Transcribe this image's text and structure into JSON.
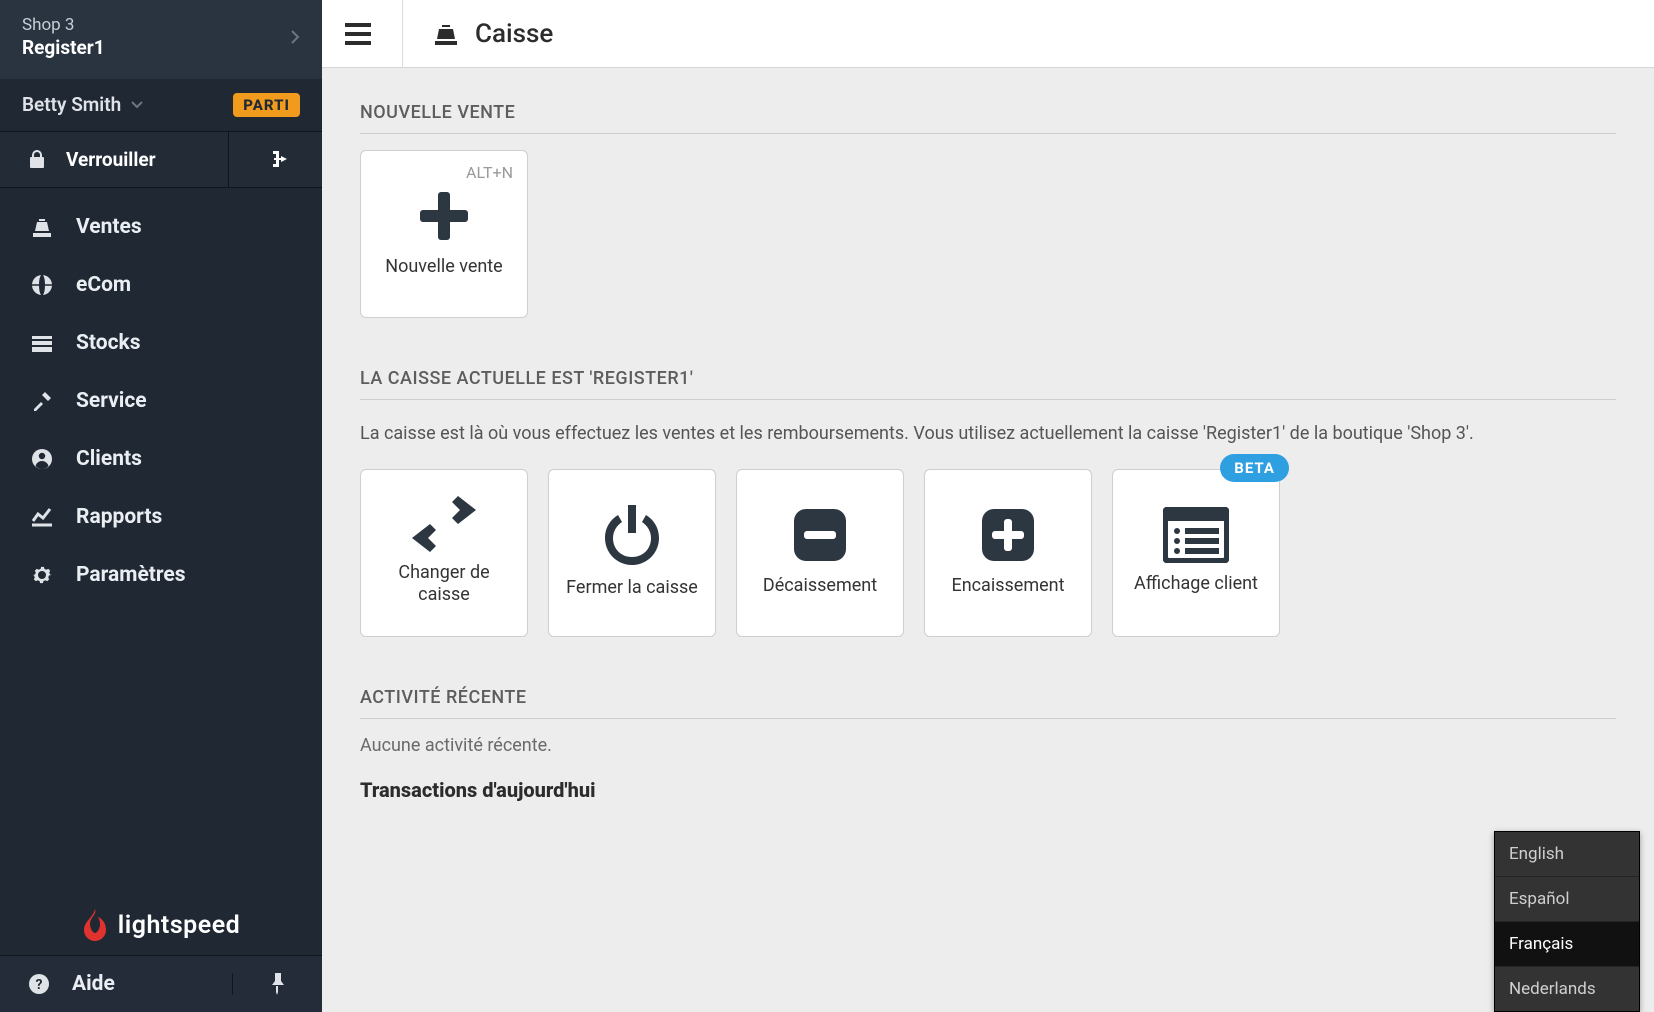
{
  "sidebar": {
    "shop": "Shop 3",
    "register": "Register1",
    "user": "Betty Smith",
    "status_badge": "PARTI",
    "lock_label": "Verrouiller",
    "nav": [
      {
        "id": "ventes",
        "label": "Ventes"
      },
      {
        "id": "ecom",
        "label": "eCom"
      },
      {
        "id": "stocks",
        "label": "Stocks"
      },
      {
        "id": "service",
        "label": "Service"
      },
      {
        "id": "clients",
        "label": "Clients"
      },
      {
        "id": "rapports",
        "label": "Rapports"
      },
      {
        "id": "parametres",
        "label": "Paramètres"
      }
    ],
    "brand": "lightspeed",
    "help_label": "Aide"
  },
  "header": {
    "title": "Caisse"
  },
  "sections": {
    "new_sale_heading": "NOUVELLE VENTE",
    "new_sale_card": {
      "label": "Nouvelle vente",
      "shortcut": "ALT+N"
    },
    "current_register_heading": "LA CAISSE ACTUELLE EST 'REGISTER1'",
    "current_register_desc": "La caisse est là où vous effectuez les ventes et les remboursements. Vous utilisez actuellement la caisse 'Register1' de la boutique 'Shop 3'.",
    "register_cards": [
      {
        "id": "change",
        "label": "Changer de caisse"
      },
      {
        "id": "close",
        "label": "Fermer la caisse"
      },
      {
        "id": "payout",
        "label": "Décaissement"
      },
      {
        "id": "payin",
        "label": "Encaissement"
      },
      {
        "id": "customer-display",
        "label": "Affichage client",
        "badge": "BETA"
      }
    ],
    "recent_heading": "ACTIVITÉ RÉCENTE",
    "recent_empty": "Aucune activité récente.",
    "today_heading": "Transactions d'aujourd'hui"
  },
  "lang_menu": {
    "options": [
      "English",
      "Español",
      "Français",
      "Nederlands"
    ],
    "selected": "Français"
  }
}
